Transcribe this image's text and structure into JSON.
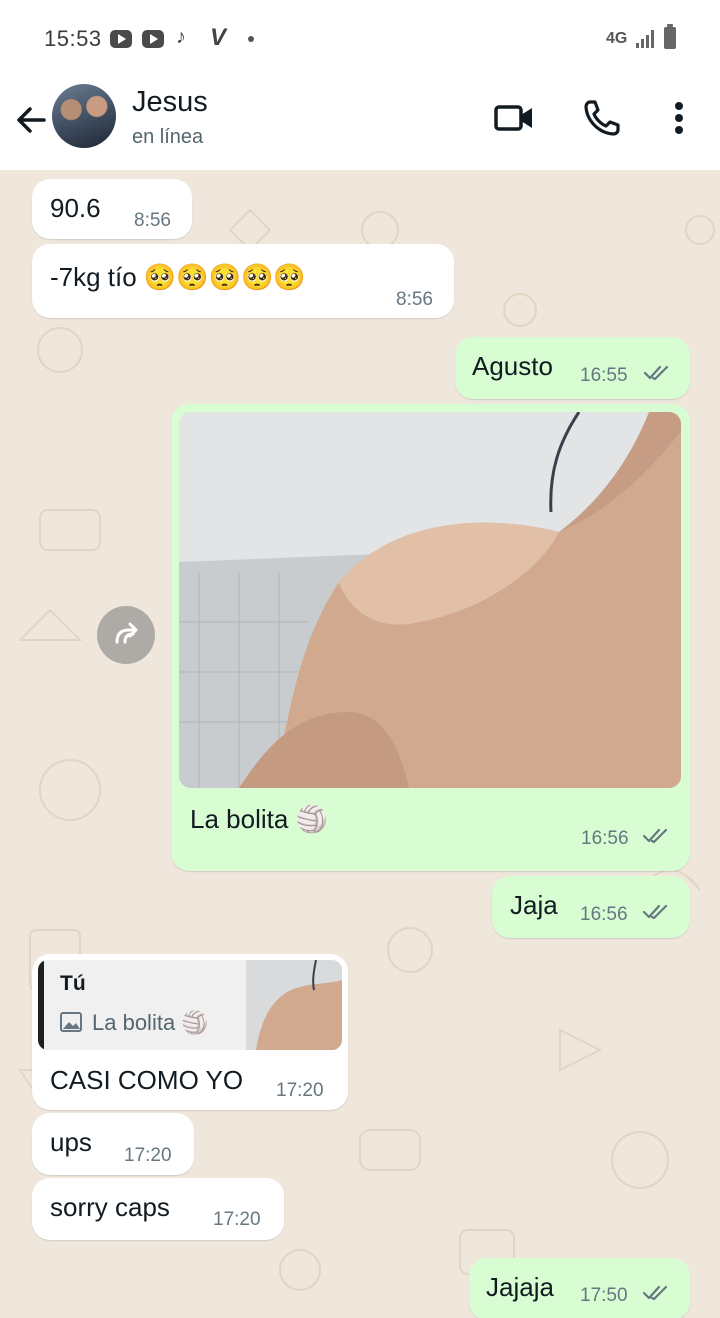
{
  "status_bar": {
    "time": "15:53",
    "network": "4G",
    "icons": [
      "youtube-icon",
      "youtube-icon",
      "tiktok-icon",
      "v-app-icon",
      "notification-dot-icon",
      "signal-icon",
      "battery-icon"
    ]
  },
  "header": {
    "contact_name": "Jesus",
    "status": "en línea",
    "icons": [
      "back-arrow-icon",
      "avatar",
      "video-call-icon",
      "phone-call-icon",
      "more-options-icon"
    ]
  },
  "messages": [
    {
      "direction": "in",
      "text": "90.6",
      "time": "8:56"
    },
    {
      "direction": "in",
      "text": "-7kg tío 🥺🥺🥺🥺🥺",
      "time": "8:56"
    },
    {
      "direction": "out",
      "text": "Agusto",
      "time": "16:55",
      "status": "read"
    },
    {
      "direction": "out",
      "type": "image",
      "caption": "La bolita 🏐",
      "time": "16:56",
      "status": "read"
    },
    {
      "direction": "out",
      "text": "Jaja",
      "time": "16:56",
      "status": "read"
    },
    {
      "direction": "in",
      "text": "CASI COMO YO",
      "time": "17:20",
      "reply_to": {
        "author": "Tú",
        "text": "La bolita 🏐"
      }
    },
    {
      "direction": "in",
      "text": "ups",
      "time": "17:20"
    },
    {
      "direction": "in",
      "text": "sorry caps",
      "time": "17:20"
    },
    {
      "direction": "out",
      "text": "Jajaja",
      "time": "17:50",
      "status": "read"
    }
  ],
  "colors": {
    "incoming_bubble": "#ffffff",
    "outgoing_bubble": "#d9fdd3",
    "chat_background": "#efe7dc",
    "timestamp": "#667781",
    "ticks": "#667781"
  }
}
